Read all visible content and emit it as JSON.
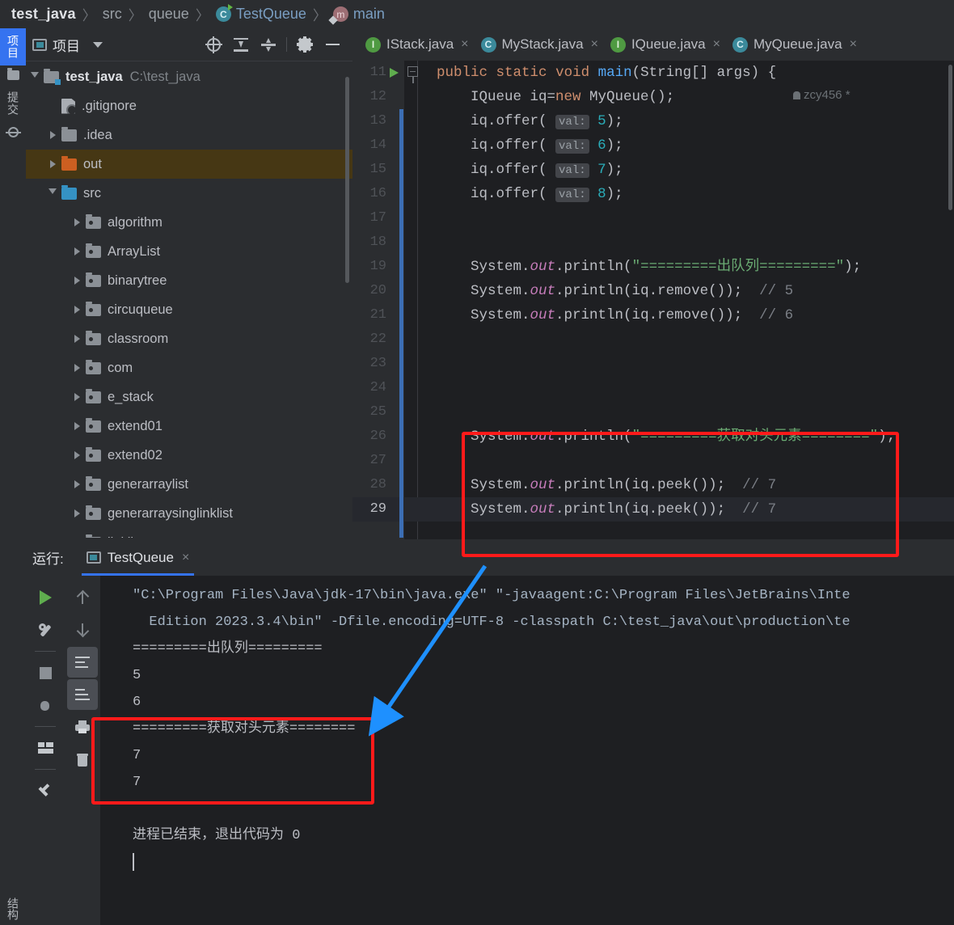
{
  "breadcrumb": {
    "project": "test_java",
    "src": "src",
    "package": "queue",
    "class": "TestQueue",
    "method": "main",
    "separator": "〉"
  },
  "left_strip": {
    "project_tab": "项目",
    "commit_tab": "提交",
    "structure_tab": "结构"
  },
  "project_panel": {
    "title": "项目",
    "buttons": [
      "select-opened-file",
      "expand-all",
      "collapse-all",
      "settings",
      "hide"
    ],
    "tree": [
      {
        "label": "test_java",
        "path": "C:\\test_java",
        "indent": 0,
        "arrow": "down",
        "icon": "module",
        "bold": true,
        "selected": false
      },
      {
        "label": ".gitignore",
        "path": "",
        "indent": 1,
        "arrow": "none",
        "icon": "gitignore",
        "bold": false,
        "selected": false
      },
      {
        "label": ".idea",
        "path": "",
        "indent": 1,
        "arrow": "right",
        "icon": "folder-grey",
        "bold": false,
        "selected": false
      },
      {
        "label": "out",
        "path": "",
        "indent": 1,
        "arrow": "right",
        "icon": "folder-orange",
        "bold": false,
        "selected": true
      },
      {
        "label": "src",
        "path": "",
        "indent": 1,
        "arrow": "down",
        "icon": "folder-blue",
        "bold": false,
        "selected": false
      },
      {
        "label": "algorithm",
        "path": "",
        "indent": 2,
        "arrow": "right",
        "icon": "package",
        "bold": false,
        "selected": false
      },
      {
        "label": "ArrayList",
        "path": "",
        "indent": 2,
        "arrow": "right",
        "icon": "package",
        "bold": false,
        "selected": false
      },
      {
        "label": "binarytree",
        "path": "",
        "indent": 2,
        "arrow": "right",
        "icon": "package",
        "bold": false,
        "selected": false
      },
      {
        "label": "circuqueue",
        "path": "",
        "indent": 2,
        "arrow": "right",
        "icon": "package",
        "bold": false,
        "selected": false
      },
      {
        "label": "classroom",
        "path": "",
        "indent": 2,
        "arrow": "right",
        "icon": "package",
        "bold": false,
        "selected": false
      },
      {
        "label": "com",
        "path": "",
        "indent": 2,
        "arrow": "right",
        "icon": "package",
        "bold": false,
        "selected": false
      },
      {
        "label": "e_stack",
        "path": "",
        "indent": 2,
        "arrow": "right",
        "icon": "package",
        "bold": false,
        "selected": false
      },
      {
        "label": "extend01",
        "path": "",
        "indent": 2,
        "arrow": "right",
        "icon": "package",
        "bold": false,
        "selected": false
      },
      {
        "label": "extend02",
        "path": "",
        "indent": 2,
        "arrow": "right",
        "icon": "package",
        "bold": false,
        "selected": false
      },
      {
        "label": "generarraylist",
        "path": "",
        "indent": 2,
        "arrow": "right",
        "icon": "package",
        "bold": false,
        "selected": false
      },
      {
        "label": "generarraysinglinklist",
        "path": "",
        "indent": 2,
        "arrow": "right",
        "icon": "package",
        "bold": false,
        "selected": false
      },
      {
        "label": "linklist",
        "path": "",
        "indent": 2,
        "arrow": "right",
        "icon": "package",
        "bold": false,
        "selected": false
      }
    ]
  },
  "editor": {
    "tabs": [
      {
        "name": "IStack.java",
        "icon": "interface",
        "close": "×"
      },
      {
        "name": "MyStack.java",
        "icon": "class",
        "close": "×"
      },
      {
        "name": "IQueue.java",
        "icon": "interface",
        "close": "×"
      },
      {
        "name": "MyQueue.java",
        "icon": "class",
        "close": "×"
      }
    ],
    "inlay_hint": "zcy456 *",
    "current_line": 29,
    "lines": [
      {
        "num": 11,
        "text": "public static void main(String[] args) {"
      },
      {
        "num": 12,
        "text": "    IQueue iq=new MyQueue();"
      },
      {
        "num": 13,
        "text": "    iq.offer( val: 5);"
      },
      {
        "num": 14,
        "text": "    iq.offer( val: 6);"
      },
      {
        "num": 15,
        "text": "    iq.offer( val: 7);"
      },
      {
        "num": 16,
        "text": "    iq.offer( val: 8);"
      },
      {
        "num": 17,
        "text": ""
      },
      {
        "num": 18,
        "text": ""
      },
      {
        "num": 19,
        "text": "    System.out.println(\"=========出队列=========\");"
      },
      {
        "num": 20,
        "text": "    System.out.println(iq.remove());  // 5"
      },
      {
        "num": 21,
        "text": "    System.out.println(iq.remove());  // 6"
      },
      {
        "num": 22,
        "text": ""
      },
      {
        "num": 23,
        "text": ""
      },
      {
        "num": 24,
        "text": ""
      },
      {
        "num": 25,
        "text": ""
      },
      {
        "num": 26,
        "text": "    System.out.println(\"=========获取对头元素========\");"
      },
      {
        "num": 27,
        "text": ""
      },
      {
        "num": 28,
        "text": "    System.out.println(iq.peek());  // 7"
      },
      {
        "num": 29,
        "text": "    System.out.println(iq.peek());  // 7"
      }
    ],
    "line19_string": "\"=========出队列=========\"",
    "line26_string": "\"=========获取对头元素========\""
  },
  "run_panel": {
    "label": "运行:",
    "tab_name": "TestQueue",
    "tab_close": "×",
    "toolbar_left": [
      "rerun",
      "settings-wrench",
      "stop",
      "debug",
      "layout",
      "pin"
    ],
    "toolbar_right": [
      "up",
      "down",
      "soft-wrap",
      "scroll-to-end",
      "print",
      "clear-all"
    ],
    "console": [
      "\"C:\\Program Files\\Java\\jdk-17\\bin\\java.exe\" \"-javaagent:C:\\Program Files\\JetBrains\\Inte",
      "  Edition 2023.3.4\\bin\" -Dfile.encoding=UTF-8 -classpath C:\\test_java\\out\\production\\te",
      "=========出队列=========",
      "5",
      "6",
      "=========获取对头元素========",
      "7",
      "7",
      "",
      "进程已结束，退出代码为 0"
    ]
  },
  "annotations": {
    "highlight_color": "#ff1a1a",
    "arrow_color": "#1e90ff",
    "editor_box_label": "peek-code-highlight",
    "console_box_label": "peek-output-highlight"
  },
  "colors": {
    "background": "#2b2d30",
    "editor_bg": "#1e1f22",
    "accent_blue": "#3573f0",
    "selected_row": "#463714",
    "string_green": "#6aab73",
    "keyword_orange": "#cf8e6d",
    "number_cyan": "#2aacb8",
    "comment_grey": "#7a7e85"
  }
}
